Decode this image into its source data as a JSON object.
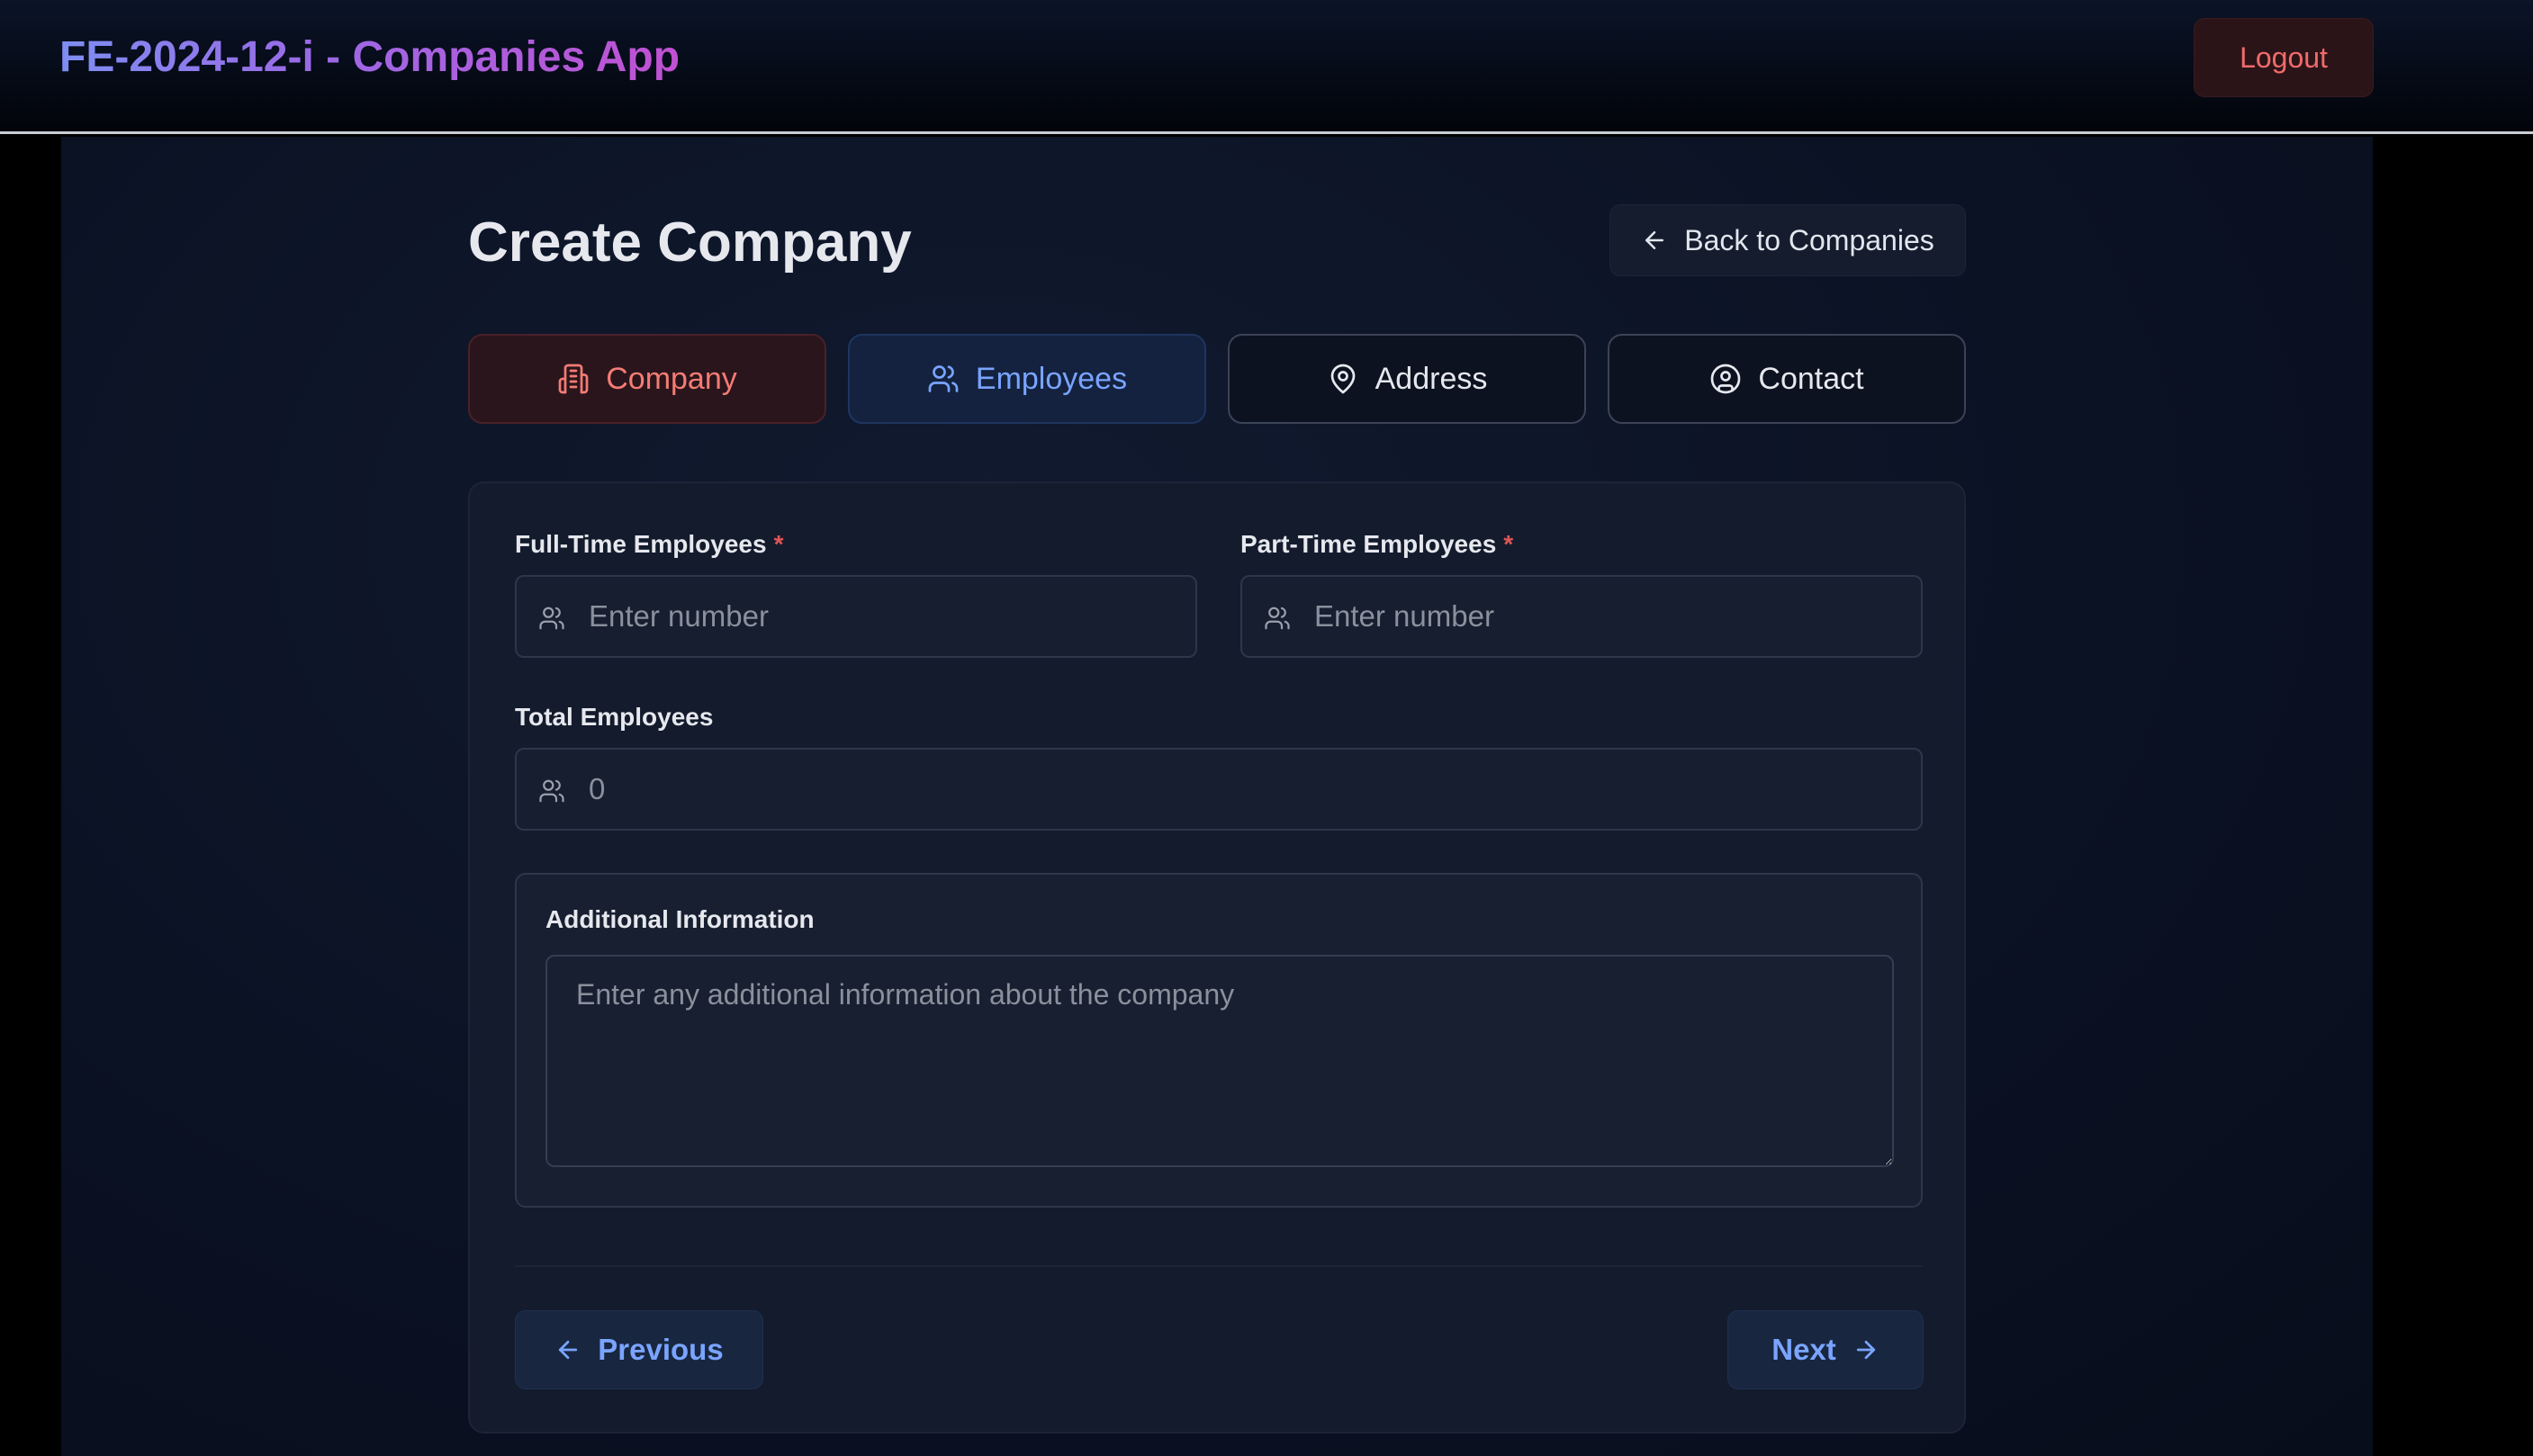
{
  "header": {
    "app_title": "FE-2024-12-i - Companies App",
    "logout_label": "Logout"
  },
  "page": {
    "title": "Create Company",
    "back_label": "Back to Companies"
  },
  "tabs": [
    {
      "label": "Company",
      "icon": "building-icon",
      "state": "completed"
    },
    {
      "label": "Employees",
      "icon": "users-icon",
      "state": "active"
    },
    {
      "label": "Address",
      "icon": "map-pin-icon",
      "state": "inactive"
    },
    {
      "label": "Contact",
      "icon": "user-circle-icon",
      "state": "inactive"
    }
  ],
  "form": {
    "full_time": {
      "label": "Full-Time Employees",
      "required_mark": "*",
      "placeholder": "Enter number",
      "value": ""
    },
    "part_time": {
      "label": "Part-Time Employees",
      "required_mark": "*",
      "placeholder": "Enter number",
      "value": ""
    },
    "total": {
      "label": "Total Employees",
      "value": "0"
    },
    "additional_info": {
      "label": "Additional Information",
      "placeholder": "Enter any additional information about the company",
      "value": ""
    }
  },
  "navigation": {
    "previous_label": "Previous",
    "next_label": "Next"
  },
  "colors": {
    "accent_blue": "#79a4ff",
    "accent_red": "#f47c74",
    "required": "#e05656",
    "background": "#0b1224"
  }
}
